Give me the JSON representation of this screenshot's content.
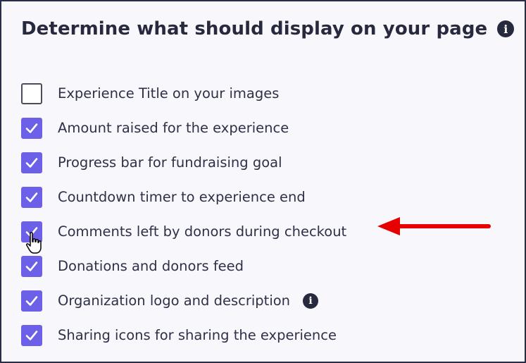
{
  "panel": {
    "title": "Determine what should display on your page",
    "title_info_icon": "info-icon"
  },
  "options": [
    {
      "label": "Experience Title on your images",
      "checked": false,
      "info": false
    },
    {
      "label": "Amount raised for the experience",
      "checked": true,
      "info": false
    },
    {
      "label": "Progress bar for fundraising goal",
      "checked": true,
      "info": false
    },
    {
      "label": "Countdown timer to experience end",
      "checked": true,
      "info": false
    },
    {
      "label": "Comments left by donors during checkout",
      "checked": true,
      "info": false
    },
    {
      "label": "Donations and donors feed",
      "checked": true,
      "info": false
    },
    {
      "label": "Organization logo and description",
      "checked": true,
      "info": true
    },
    {
      "label": "Sharing icons for sharing the experience",
      "checked": true,
      "info": false
    }
  ],
  "colors": {
    "accent": "#6c5fe8",
    "text": "#2e3047",
    "annotation_arrow": "#e60000",
    "border": "#2a2d47"
  },
  "icons": {
    "check": "check-icon",
    "info": "info-icon",
    "cursor": "hand-pointer-icon",
    "arrow": "annotation-arrow-icon"
  }
}
